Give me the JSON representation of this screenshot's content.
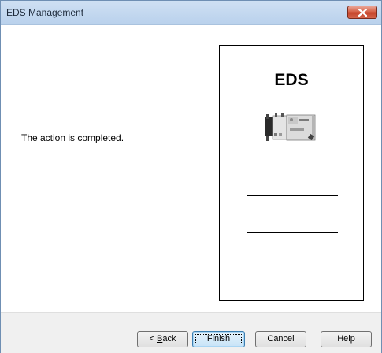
{
  "window": {
    "title": "EDS Management",
    "close_icon": "close-icon"
  },
  "content": {
    "message": "The action is completed.",
    "illustration": {
      "heading": "EDS",
      "device_icon": "device-module-icon"
    }
  },
  "buttons": {
    "back": {
      "prefix": "< ",
      "mnemonic": "B",
      "rest": "ack"
    },
    "finish": "Finish",
    "cancel": "Cancel",
    "help": "Help"
  },
  "colors": {
    "titlebar": "#c4d9f0",
    "close_button": "#c94a31",
    "footer": "#f0f0f0",
    "default_button_border": "#3c7fb1"
  }
}
